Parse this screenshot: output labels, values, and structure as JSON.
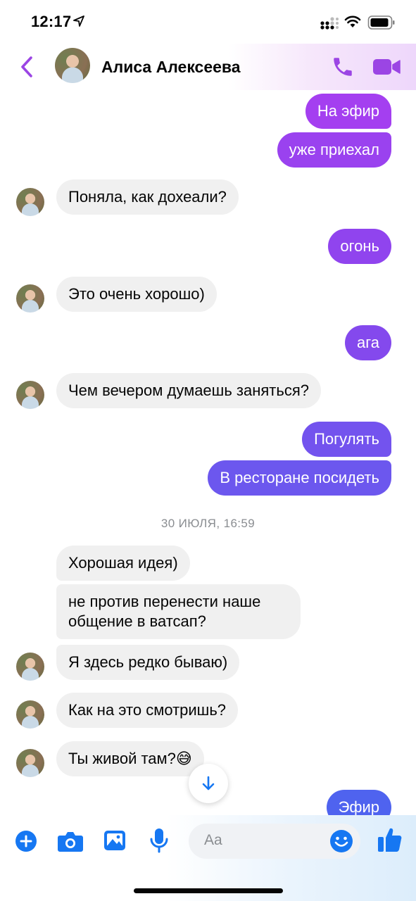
{
  "status_bar": {
    "time": "12:17"
  },
  "header": {
    "contact_name": "Алиса Алексеева"
  },
  "messages": [
    {
      "from": "me",
      "text": "На эфир"
    },
    {
      "from": "me",
      "text": "уже приехал"
    },
    {
      "from": "contact",
      "text": "Поняла, как дохеали?"
    },
    {
      "from": "me",
      "text": "огонь"
    },
    {
      "from": "contact",
      "text": "Это очень хорошо)"
    },
    {
      "from": "me",
      "text": "ага"
    },
    {
      "from": "contact",
      "text": "Чем вечером думаешь заняться?"
    },
    {
      "from": "me",
      "text": "Погулять"
    },
    {
      "from": "me",
      "text": "В ресторане посидеть"
    },
    {
      "from": "contact",
      "text": "Хорошая идея)"
    },
    {
      "from": "contact",
      "line1": "не против перенести наше",
      "line2": "общение в ватсап?"
    },
    {
      "from": "contact",
      "text": "Я здесь редко бываю)"
    },
    {
      "from": "contact",
      "text": "Как на это смотришь?"
    },
    {
      "from": "contact",
      "text": "Ты живой там?",
      "emoji": "😅"
    },
    {
      "from": "me",
      "text": "Эфир"
    }
  ],
  "timestamp": "30 ИЮЛЯ, 16:59",
  "composer": {
    "placeholder": "Aa"
  },
  "colors": {
    "accent_purple": "#9b45e4",
    "bubble_top": "#a93ff0",
    "bubble_bottom": "#3b67f0",
    "incoming_bubble": "#f0f0f0",
    "composer_blue": "#1677f2"
  },
  "icons": [
    "location-arrow-icon",
    "signal-icon",
    "wifi-icon",
    "battery-icon",
    "back-chevron-icon",
    "phone-icon",
    "video-camera-icon",
    "arrow-down-icon",
    "plus-circle-icon",
    "camera-icon",
    "gallery-icon",
    "microphone-icon",
    "emoji-icon",
    "thumbs-up-icon"
  ]
}
